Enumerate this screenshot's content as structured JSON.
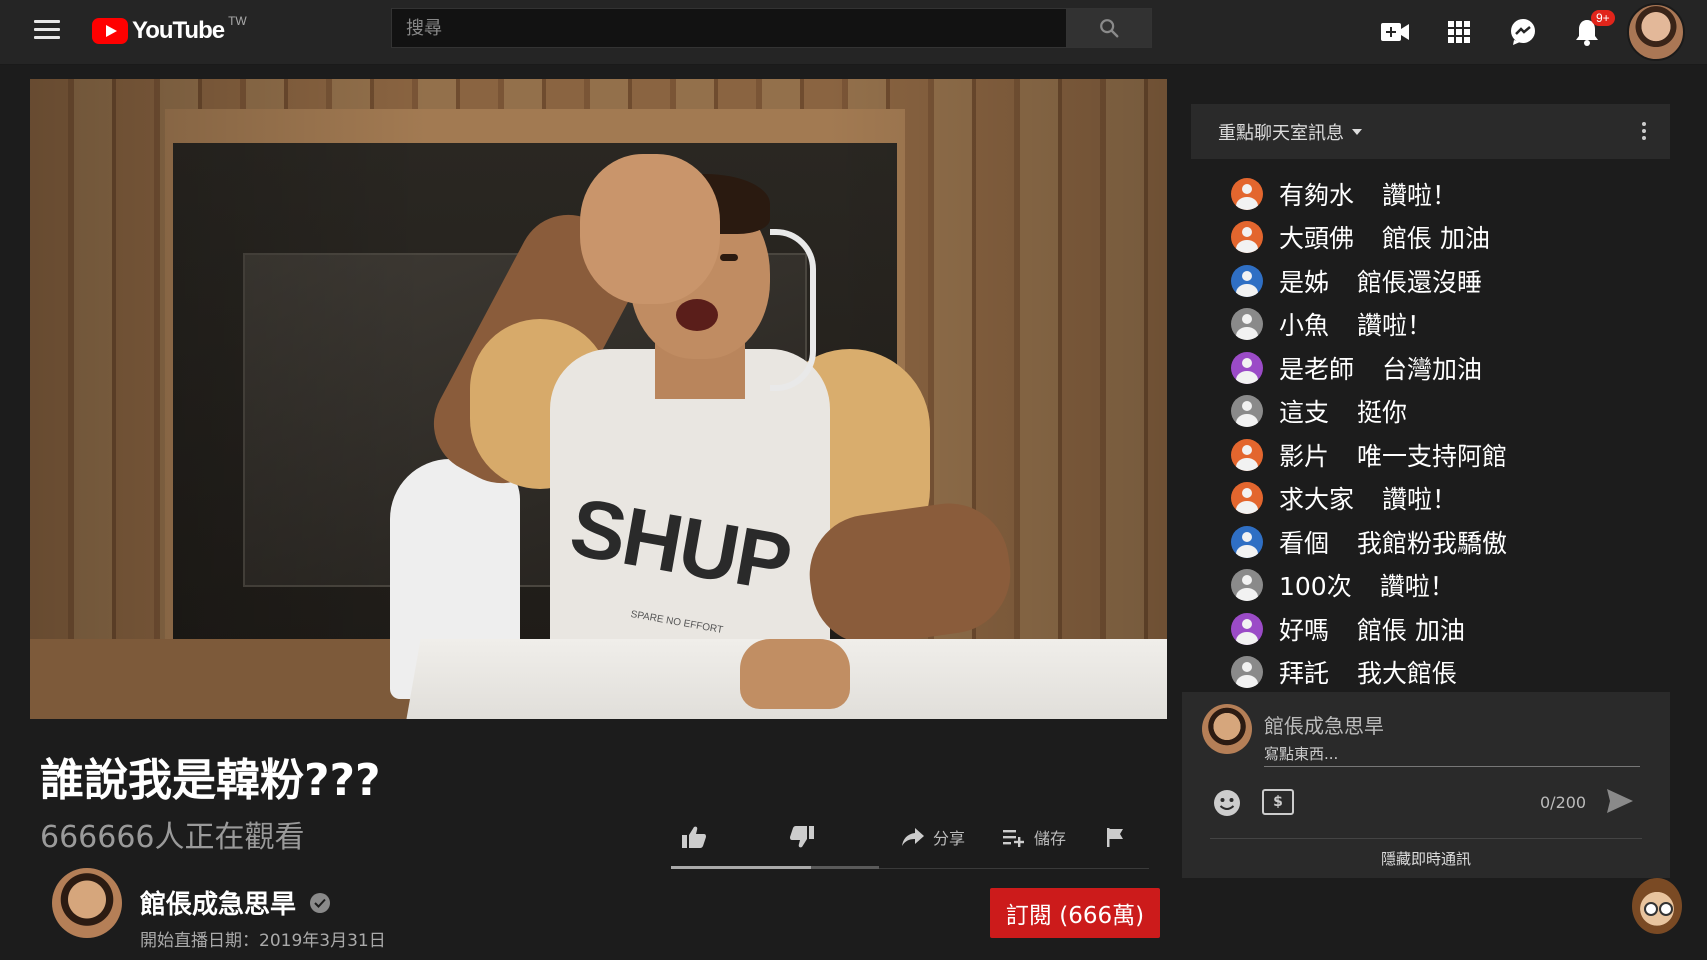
{
  "header": {
    "logo_text": "YouTube",
    "region": "TW",
    "search_placeholder": "搜尋",
    "notification_badge": "9+"
  },
  "video": {
    "title": "誰說我是韓粉???",
    "watching": "666666人正在觀看",
    "shirt_text": "SHUP",
    "shirt_subtext": "SPARE NO EFFORT"
  },
  "actions": {
    "share_label": "分享",
    "save_label": "儲存"
  },
  "channel": {
    "name": "館倀成急思旱",
    "live_date": "開始直播日期：2019年3月31日",
    "subscribe_label": "訂閱 (666萬)"
  },
  "chat": {
    "mode_label": "重點聊天室訊息",
    "messages": [
      {
        "author": "有夠水",
        "text": "讚啦！",
        "color": "#e3662e"
      },
      {
        "author": "大頭佛",
        "text": "館倀 加油",
        "color": "#e3662e"
      },
      {
        "author": "是姊",
        "text": "館倀還沒睡",
        "color": "#2f6fc4"
      },
      {
        "author": "小魚",
        "text": "讚啦！",
        "color": "#8a8a8a"
      },
      {
        "author": "是老師",
        "text": "台灣加油",
        "color": "#9b4bc7"
      },
      {
        "author": "這支",
        "text": "挺你",
        "color": "#8a8a8a"
      },
      {
        "author": "影片",
        "text": "唯一支持阿館",
        "color": "#e3662e"
      },
      {
        "author": "求大家",
        "text": "讚啦！",
        "color": "#e3662e"
      },
      {
        "author": "看個",
        "text": "我館粉我驕傲",
        "color": "#2f6fc4"
      },
      {
        "author": "100次",
        "text": "讚啦！",
        "color": "#8a8a8a"
      },
      {
        "author": "好嗎",
        "text": "館倀 加油",
        "color": "#9b4bc7"
      },
      {
        "author": "拜託",
        "text": "我大館倀",
        "color": "#8a8a8a"
      }
    ],
    "composer": {
      "user_name": "館倀成急思旱",
      "placeholder": "寫點東西...",
      "char_count": "0/200",
      "superchat_glyph": "$",
      "hide_label": "隱藏即時通訊"
    }
  }
}
